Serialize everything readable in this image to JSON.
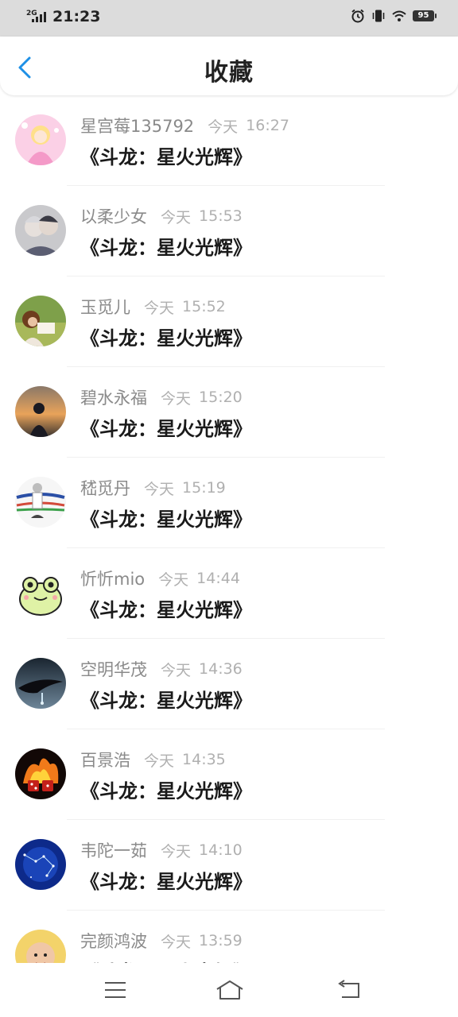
{
  "status_bar": {
    "network": "2G",
    "time": "21:23",
    "battery": "95",
    "icons": [
      "signal-icon",
      "alarm-icon",
      "vibrate-icon",
      "wifi-icon",
      "battery-icon"
    ]
  },
  "header": {
    "title": "收藏",
    "back_icon": "chevron-left-icon",
    "accent_color": "#1e90e6"
  },
  "favorites": [
    {
      "name": "星宫莓135792",
      "day": "今天",
      "time": "16:27",
      "book": "《斗龙：星火光辉》"
    },
    {
      "name": "以柔少女",
      "day": "今天",
      "time": "15:53",
      "book": "《斗龙：星火光辉》"
    },
    {
      "name": "玉觅儿",
      "day": "今天",
      "time": "15:52",
      "book": "《斗龙：星火光辉》"
    },
    {
      "name": "碧水永福",
      "day": "今天",
      "time": "15:20",
      "book": "《斗龙：星火光辉》"
    },
    {
      "name": "嵇觅丹",
      "day": "今天",
      "time": "15:19",
      "book": "《斗龙：星火光辉》"
    },
    {
      "name": "忻忻mio",
      "day": "今天",
      "time": "14:44",
      "book": "《斗龙：星火光辉》"
    },
    {
      "name": "空明华茂",
      "day": "今天",
      "time": "14:36",
      "book": "《斗龙：星火光辉》"
    },
    {
      "name": "百景浩",
      "day": "今天",
      "time": "14:35",
      "book": "《斗龙：星火光辉》"
    },
    {
      "name": "韦陀一茹",
      "day": "今天",
      "time": "14:10",
      "book": "《斗龙：星火光辉》"
    },
    {
      "name": "完颜鸿波",
      "day": "今天",
      "time": "13:59",
      "book": "《斗龙：星火光辉》"
    }
  ],
  "nav_bar": {
    "icons": [
      "menu-icon",
      "home-icon",
      "back-icon"
    ]
  }
}
